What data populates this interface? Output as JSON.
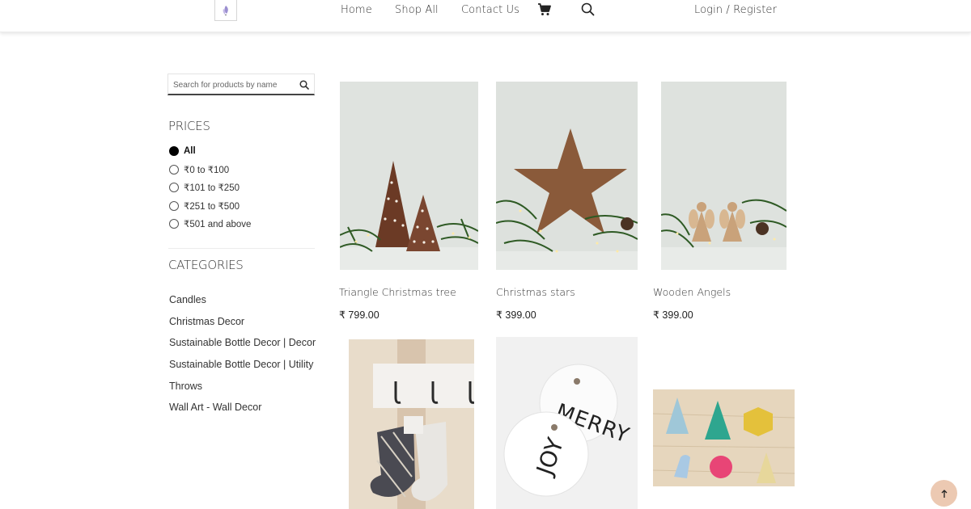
{
  "nav": {
    "home": "Home",
    "shop_all": "Shop All",
    "contact": "Contact Us",
    "login": "Login / Register",
    "cart_icon": "cart-icon",
    "search_icon": "search-icon"
  },
  "search": {
    "placeholder": "Search for products by name",
    "value": ""
  },
  "prices": {
    "title": "PRICES",
    "options": [
      {
        "label": "All",
        "selected": true
      },
      {
        "label": "₹0 to ₹100",
        "selected": false
      },
      {
        "label": "₹101 to ₹250",
        "selected": false
      },
      {
        "label": "₹251 to ₹500",
        "selected": false
      },
      {
        "label": "₹501 and above",
        "selected": false
      }
    ]
  },
  "categories": {
    "title": "CATEGORIES",
    "items": [
      "Candles",
      "Christmas Decor",
      "Sustainable Bottle Decor | Decor",
      "Sustainable Bottle Decor | Utility",
      "Throws",
      "Wall Art - Wall Decor"
    ]
  },
  "products": [
    {
      "name": "Triangle Christmas tree",
      "price": "₹ 799.00"
    },
    {
      "name": "Christmas stars",
      "price": "₹ 399.00"
    },
    {
      "name": "Wooden Angels",
      "price": "₹ 399.00"
    },
    {
      "name": "",
      "price": ""
    },
    {
      "name": "",
      "price": ""
    },
    {
      "name": "",
      "price": ""
    }
  ],
  "colors": {
    "accent": "#ecc9b2",
    "text": "#333333",
    "background": "#ffffff"
  }
}
